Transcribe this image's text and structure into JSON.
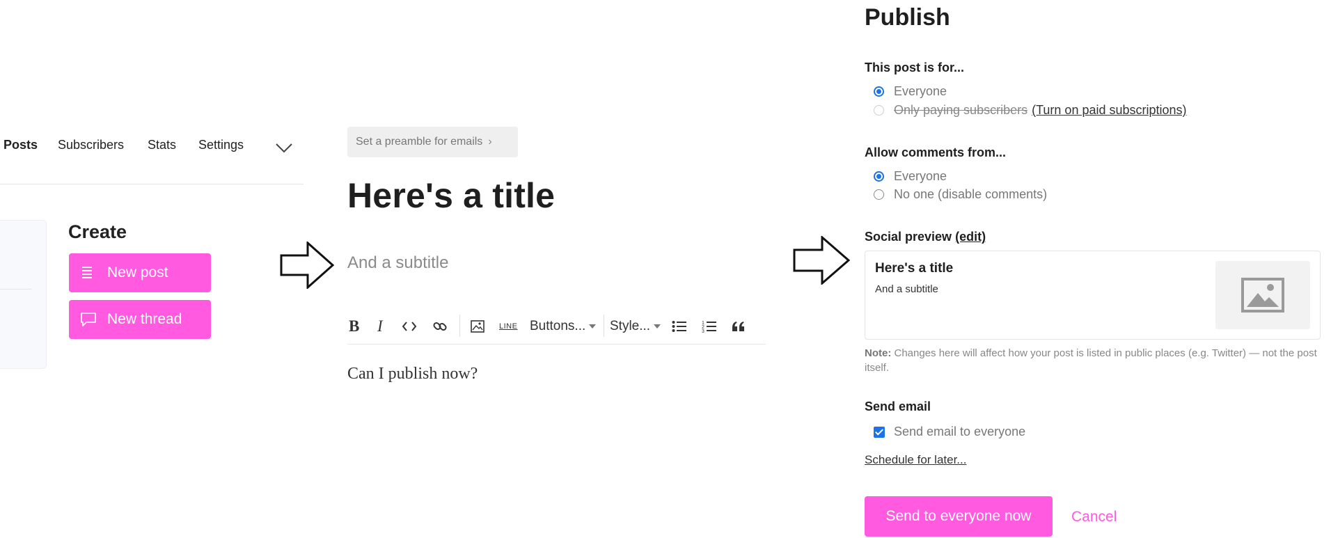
{
  "nav": {
    "items": [
      {
        "label": "Posts",
        "active": true
      },
      {
        "label": "Subscribers"
      },
      {
        "label": "Stats"
      },
      {
        "label": "Settings"
      }
    ],
    "more_icon": "chevron-down-icon"
  },
  "create": {
    "title": "Create",
    "new_post": "New post",
    "new_thread": "New thread"
  },
  "editor": {
    "preamble": "Set a preamble for emails",
    "title": "Here's a title",
    "subtitle": "And a subtitle",
    "toolbar": {
      "bold": "B",
      "italic": "I",
      "line": "LINE",
      "buttons": "Buttons...",
      "style": "Style..."
    },
    "body": "Can I publish now?"
  },
  "publish": {
    "title": "Publish",
    "audience_label": "This post is for...",
    "audience_everyone": "Everyone",
    "audience_paid": "Only paying subscribers",
    "paid_link": "(Turn on paid subscriptions)",
    "comments_label": "Allow comments from...",
    "comments_everyone": "Everyone",
    "comments_none": "No one (disable comments)",
    "social_label": "Social preview",
    "social_edit": "(edit)",
    "social_title": "Here's a title",
    "social_subtitle": "And a subtitle",
    "note_bold": "Note:",
    "note_text": "Changes here will affect how your post is listed in public places (e.g. Twitter) — not the post itself.",
    "send_email_label": "Send email",
    "send_email_option": "Send email to everyone",
    "schedule": "Schedule for later...",
    "send_button": "Send to everyone now",
    "cancel": "Cancel"
  },
  "colors": {
    "accent_pink": "#ff5ae0",
    "radio_blue": "#1a73e8"
  }
}
